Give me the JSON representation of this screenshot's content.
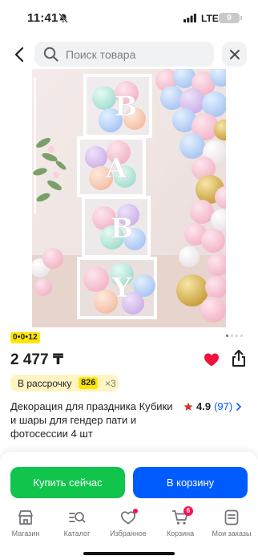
{
  "status_bar": {
    "time": "11:41",
    "network": "LTE",
    "battery": "9"
  },
  "search": {
    "placeholder": "Поиск товара"
  },
  "gallery": {
    "image_alt": "BABY",
    "page_count": 4,
    "active_index": 0
  },
  "product": {
    "promo": "0•0•12",
    "price": "2 477 ₸",
    "installment_label": "В рассрочку",
    "installment_amount": "826",
    "installment_multiplier": "×3",
    "title": "Декорация для праздника Кубики и шары для гендер пати и фотосессии 4 шт",
    "rating": "4.9",
    "reviews": "(97)",
    "colors": {
      "accent": "#005bff",
      "buy": "#10c44c",
      "favorite": "#f91155",
      "promo": "#ffe600"
    }
  },
  "actions": {
    "buy_now": "Купить сейчас",
    "add_to_cart": "В корзину"
  },
  "tabs": [
    {
      "label": "Магазин",
      "icon": "shop-icon"
    },
    {
      "label": "Каталог",
      "icon": "catalog-icon"
    },
    {
      "label": "Избранное",
      "icon": "heart-icon"
    },
    {
      "label": "Корзина",
      "icon": "cart-icon",
      "badge": "6"
    },
    {
      "label": "Мои заказы",
      "icon": "orders-icon"
    }
  ]
}
